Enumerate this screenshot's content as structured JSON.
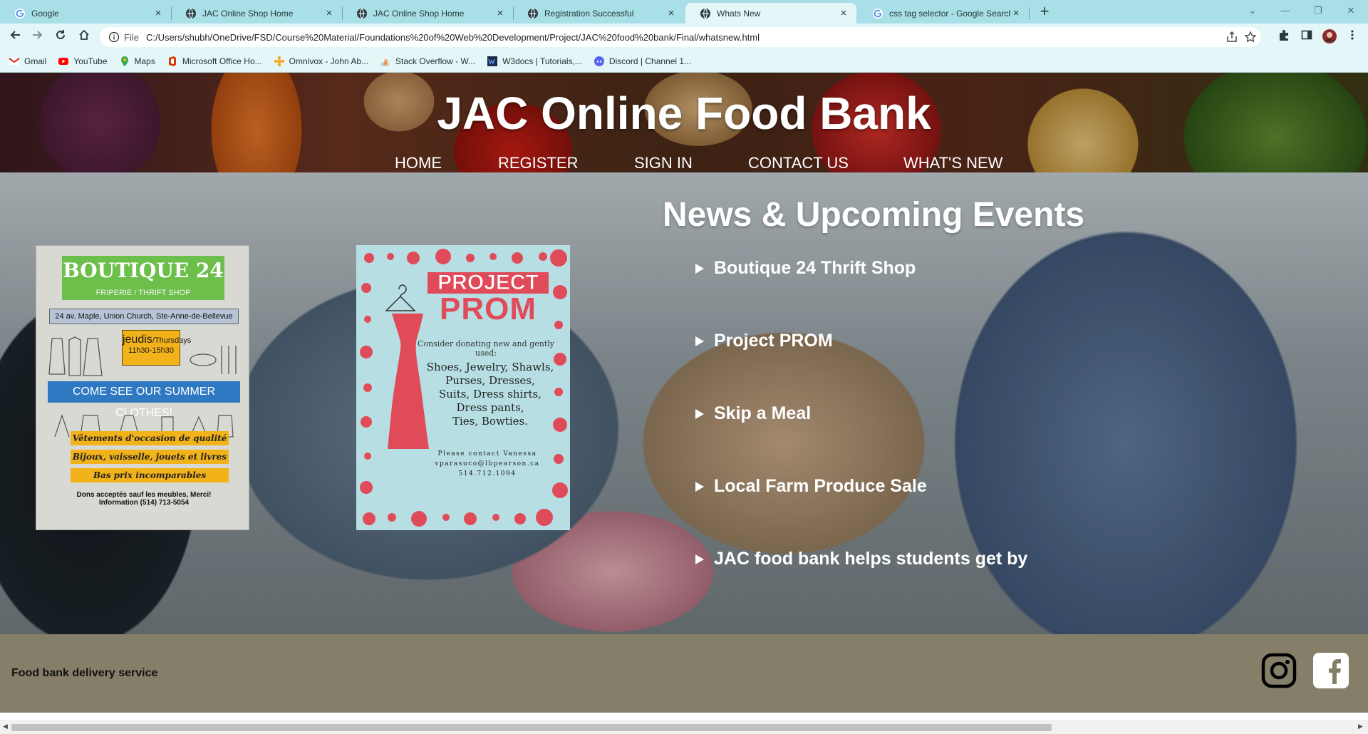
{
  "browser": {
    "tabs": [
      {
        "title": "Google",
        "icon": "google-icon",
        "active": false
      },
      {
        "title": "JAC Online Shop Home",
        "icon": "globe-icon",
        "active": false
      },
      {
        "title": "JAC Online Shop Home",
        "icon": "globe-icon",
        "active": false
      },
      {
        "title": "Registration Successful",
        "icon": "globe-icon",
        "active": false
      },
      {
        "title": "Whats New",
        "icon": "globe-icon",
        "active": true
      },
      {
        "title": "css tag selector - Google Search",
        "icon": "google-icon",
        "active": false
      }
    ],
    "address": {
      "scheme": "File",
      "url": "C:/Users/shubh/OneDrive/FSD/Course%20Material/Foundations%20of%20Web%20Development/Project/JAC%20food%20bank/Final/whatsnew.html"
    },
    "bookmarks": [
      {
        "label": "Gmail",
        "icon": "gmail-icon",
        "color": "#d93025"
      },
      {
        "label": "YouTube",
        "icon": "youtube-icon",
        "color": "#ff0000"
      },
      {
        "label": "Maps",
        "icon": "maps-icon",
        "color": "#34a853"
      },
      {
        "label": "Microsoft Office Ho...",
        "icon": "office-icon",
        "color": "#d83b01"
      },
      {
        "label": "Omnivox - John Ab...",
        "icon": "omnivox-icon",
        "color": "#f5a623"
      },
      {
        "label": "Stack Overflow - W...",
        "icon": "stackoverflow-icon",
        "color": "#f48024"
      },
      {
        "label": "W3docs | Tutorials,...",
        "icon": "w3docs-icon",
        "color": "#1e2a4a"
      },
      {
        "label": "Discord | Channel 1...",
        "icon": "discord-icon",
        "color": "#5865f2"
      }
    ]
  },
  "site": {
    "title": "JAC Online Food Bank",
    "nav": [
      "HOME",
      "REGISTER",
      "SIGN IN",
      "CONTACT US",
      "WHAT'S NEW"
    ]
  },
  "posters": {
    "boutique": {
      "title": "BOUTIQUE 24",
      "subtitle": "FRIPERIE / THRIFT SHOP",
      "address": "24 av. Maple, Union Church, Ste-Anne-de-Bellevue",
      "day": "jeudis",
      "day_en": "/Thursdays",
      "hours": "11h30-15h30",
      "banner": "COME SEE OUR SUMMER CLOTHES!",
      "lines": [
        "Vêtements d'occasion de qualité",
        "Bijoux, vaisselle, jouets et livres",
        "Bas prix incomparables"
      ],
      "foot1": "Dons acceptés sauf les meubles, Merci!",
      "foot2": "Information (514) 713-5054"
    },
    "prom": {
      "title1": "PROJECT",
      "title2": "PROM",
      "consider": "Consider donating new and gently used:",
      "items": [
        "Shoes, Jewelry, Shawls,",
        "Purses, Dresses,",
        "Suits, Dress shirts,",
        "Dress pants,",
        "Ties, Bowties."
      ],
      "contact1": "Please contact Vanessa",
      "contact2": "vparasuco@lbpearson.ca",
      "contact3": "514.712.1094"
    }
  },
  "news": {
    "heading": "News & Upcoming Events",
    "items": [
      "Boutique 24 Thrift Shop",
      "Project PROM",
      "Skip a Meal",
      "Local Farm Produce Sale",
      "JAC food bank helps students get by"
    ]
  },
  "footer": {
    "text": "Food bank delivery service"
  },
  "colors": {
    "tabstrip": "#a9dfe6",
    "toolbar": "#e4f6f8",
    "footer": "#857f6a"
  }
}
